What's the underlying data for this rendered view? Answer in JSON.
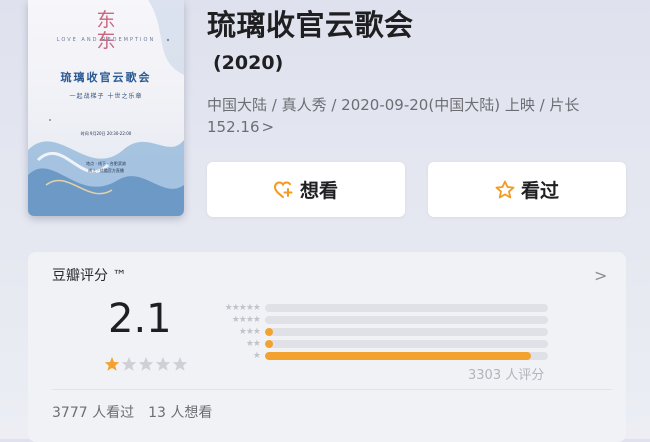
{
  "poster": {
    "seal_text": "东",
    "seal_text2": "东",
    "english": "LOVE AND REDEMPTION",
    "art_title": "琉璃收官云歌会",
    "art_subtitle": "一起战梯子  十世之乐章",
    "time_text": "时间  9月20日  20:30-22:00",
    "loc_text": "地点 · 线下 · 合肥滨湖\n线上 · 优酷官方直播"
  },
  "movie": {
    "title": "琉璃收官云歌会",
    "year": "(2020)",
    "meta": "中国大陆 / 真人秀 / 2020-09-20(中国大陆) 上映 / 片长152.16",
    "meta_chevron": ">"
  },
  "actions": {
    "want_label": "想看",
    "seen_label": "看过",
    "want_icon": "heart-plus-icon",
    "seen_icon": "star-outline-icon"
  },
  "rating": {
    "title": "豆瓣评分 ™",
    "chevron": ">",
    "score": "2.1",
    "score_stars": 1,
    "distribution_percent": {
      "five": 0,
      "four": 0,
      "three": 3,
      "two": 3,
      "one": 94
    },
    "star_row_labels": [
      "★★★★★",
      "★★★★",
      "★★★",
      "★★",
      "★"
    ],
    "votes": "3303 人评分"
  },
  "stats": {
    "seen": "3777 人看过",
    "want": "13 人想看"
  },
  "colors": {
    "accent_orange": "#f3a230",
    "track_grey": "#e0e1e7",
    "want_icon_orange": "#f39a1f",
    "background": "#e2e5ef"
  }
}
